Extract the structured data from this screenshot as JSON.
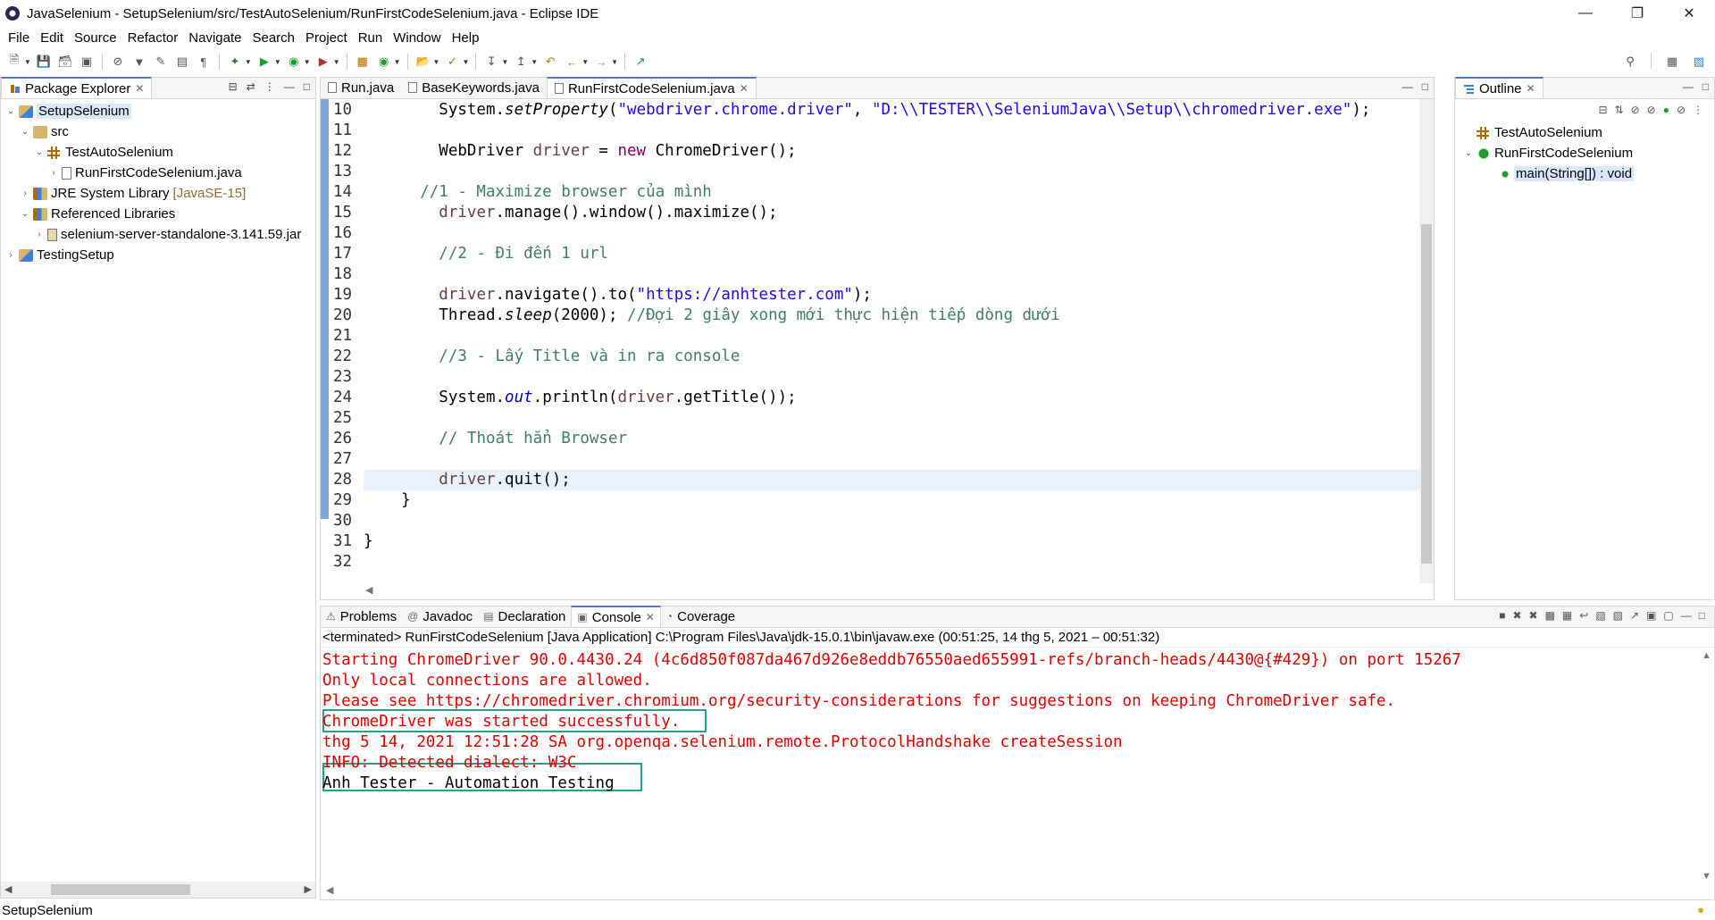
{
  "window": {
    "title": "JavaSelenium - SetupSelenium/src/TestAutoSelenium/RunFirstCodeSelenium.java - Eclipse IDE"
  },
  "menu": [
    "File",
    "Edit",
    "Source",
    "Refactor",
    "Navigate",
    "Search",
    "Project",
    "Run",
    "Window",
    "Help"
  ],
  "package_explorer": {
    "title": "Package Explorer",
    "tree": [
      {
        "level": 0,
        "twisty": "⌄",
        "icon": "project-icon",
        "label": "SetupSelenium",
        "selected": true
      },
      {
        "level": 1,
        "twisty": "⌄",
        "icon": "src-folder-icon",
        "label": "src"
      },
      {
        "level": 2,
        "twisty": "⌄",
        "icon": "package-icon",
        "label": "TestAutoSelenium"
      },
      {
        "level": 3,
        "twisty": "›",
        "icon": "java-file-icon",
        "label": "RunFirstCodeSelenium.java"
      },
      {
        "level": 1,
        "twisty": "›",
        "icon": "library-icon",
        "label": "JRE System Library",
        "suffix": "[JavaSE-15]"
      },
      {
        "level": 1,
        "twisty": "⌄",
        "icon": "library-icon",
        "label": "Referenced Libraries"
      },
      {
        "level": 2,
        "twisty": "›",
        "icon": "jar-icon",
        "label": "selenium-server-standalone-3.141.59.jar"
      },
      {
        "level": 0,
        "twisty": "›",
        "icon": "project-icon",
        "label": "TestingSetup"
      }
    ]
  },
  "editor": {
    "tabs": [
      {
        "label": "Run.java",
        "active": false
      },
      {
        "label": "BaseKeywords.java",
        "active": false
      },
      {
        "label": "RunFirstCodeSelenium.java",
        "active": true
      }
    ],
    "lines": [
      {
        "n": "10",
        "html": "        System.<span class=\"sm\">setProperty</span>(<span class=\"str\">\"webdriver.chrome.driver\"</span>, <span class=\"str\">\"D:\\\\TESTER\\\\SeleniumJava\\\\Setup\\\\chromedriver.exe\"</span>);"
      },
      {
        "n": "11",
        "html": ""
      },
      {
        "n": "12",
        "html": "        WebDriver <span class=\"var\">driver</span> = <span class=\"kw\">new</span> ChromeDriver();"
      },
      {
        "n": "13",
        "html": ""
      },
      {
        "n": "14",
        "html": "      <span class=\"cmt\">//1 - Maximize browser của mình</span>"
      },
      {
        "n": "15",
        "html": "        <span class=\"var\">driver</span>.manage().window().maximize();"
      },
      {
        "n": "16",
        "html": ""
      },
      {
        "n": "17",
        "html": "        <span class=\"cmt\">//2 - Đi đến 1 url</span>"
      },
      {
        "n": "18",
        "html": ""
      },
      {
        "n": "19",
        "html": "        <span class=\"var\">driver</span>.navigate().to(<span class=\"str\">\"https://anhtester.com\"</span>);"
      },
      {
        "n": "20",
        "html": "        Thread.<span class=\"sm\">sleep</span>(2000); <span class=\"cmt\">//Đợi 2 giây xong mới thực hiện tiếp dòng dưới</span>"
      },
      {
        "n": "21",
        "html": ""
      },
      {
        "n": "22",
        "html": "        <span class=\"cmt\">//3 - Lấy Title và in ra console</span>"
      },
      {
        "n": "23",
        "html": ""
      },
      {
        "n": "24",
        "html": "        System.<span class=\"fld\">out</span>.println(<span class=\"var\">driver</span>.getTitle());"
      },
      {
        "n": "25",
        "html": ""
      },
      {
        "n": "26",
        "html": "        <span class=\"cmt\">// Thoát hẳn Browser</span>"
      },
      {
        "n": "27",
        "html": ""
      },
      {
        "n": "28",
        "html": "        <span class=\"var\">driver</span>.quit();",
        "current": true
      },
      {
        "n": "29",
        "html": "    }"
      },
      {
        "n": "30",
        "html": ""
      },
      {
        "n": "31",
        "html": "}"
      },
      {
        "n": "32",
        "html": ""
      }
    ]
  },
  "outline": {
    "title": "Outline",
    "items": [
      {
        "level": 0,
        "twisty": "",
        "label": "TestAutoSelenium"
      },
      {
        "level": 0,
        "twisty": "⌄",
        "label": "RunFirstCodeSelenium"
      },
      {
        "level": 1,
        "twisty": "",
        "label": "main(String[]) : void",
        "selected": true
      }
    ]
  },
  "bottom": {
    "tabs": [
      {
        "label": "Problems",
        "active": false
      },
      {
        "label": "Javadoc",
        "active": false
      },
      {
        "label": "Declaration",
        "active": false
      },
      {
        "label": "Console",
        "active": true
      },
      {
        "label": "Coverage",
        "active": false
      }
    ],
    "console_header": "<terminated> RunFirstCodeSelenium [Java Application] C:\\Program Files\\Java\\jdk-15.0.1\\bin\\javaw.exe  (00:51:25, 14 thg 5, 2021 – 00:51:32)",
    "lines": [
      {
        "text": "Starting ChromeDriver 90.0.4430.24 (4c6d850f087da467d926e8eddb76550aed655991-refs/branch-heads/4430@{#429}) on port 15267",
        "stream": "err"
      },
      {
        "text": "Only local connections are allowed.",
        "stream": "err"
      },
      {
        "text": "Please see https://chromedriver.chromium.org/security-considerations for suggestions on keeping ChromeDriver safe.",
        "stream": "err"
      },
      {
        "text": "ChromeDriver was started successfully.",
        "stream": "err"
      },
      {
        "text": "thg 5 14, 2021 12:51:28 SA org.openqa.selenium.remote.ProtocolHandshake createSession",
        "stream": "err"
      },
      {
        "text": "INFO: Detected dialect: W3C",
        "stream": "err"
      },
      {
        "text": "Anh Tester - Automation Testing",
        "stream": "out"
      }
    ]
  },
  "status": {
    "text": "SetupSelenium"
  },
  "colors": {
    "accent": "#3c80d9",
    "error_text": "#e00000",
    "highlight_box": "#25a08c",
    "current_line": "#e8f2fe"
  }
}
